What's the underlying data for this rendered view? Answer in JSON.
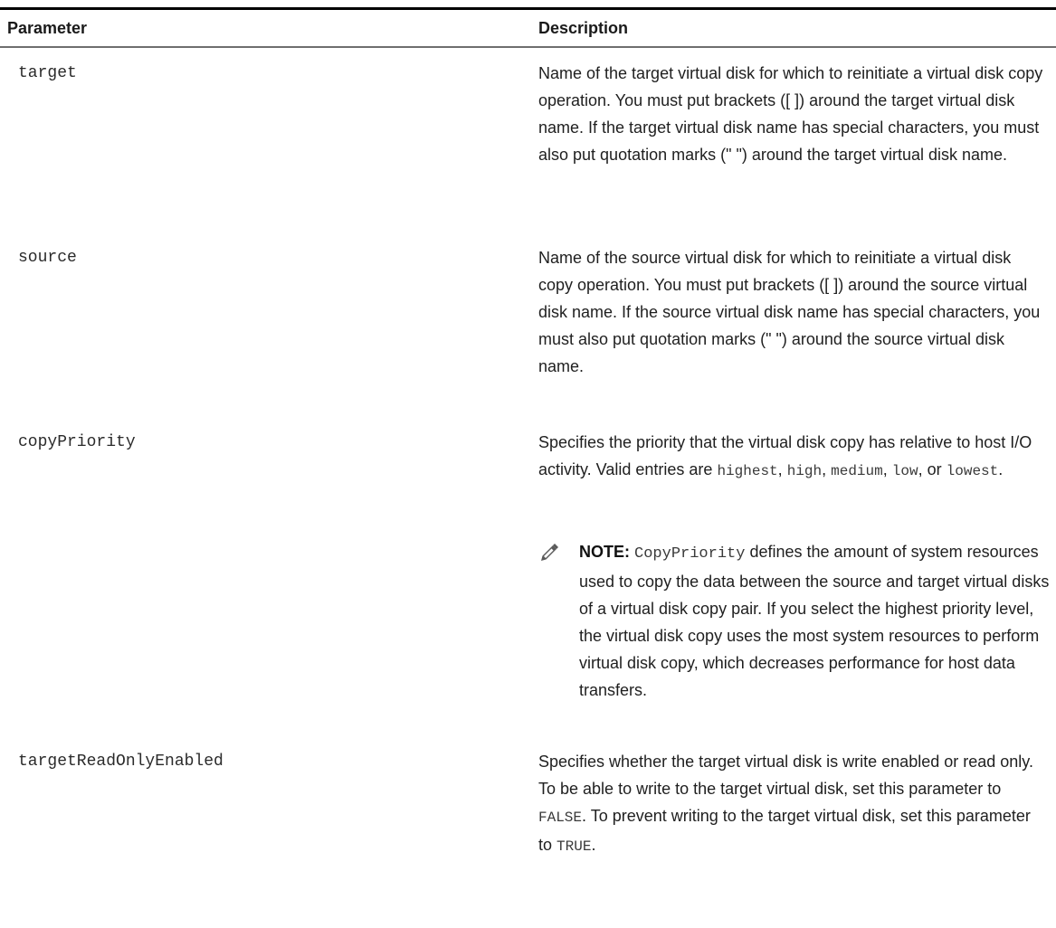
{
  "table": {
    "headers": {
      "parameter": "Parameter",
      "description": "Description"
    },
    "rows": [
      {
        "name": "target",
        "description": "Name of the target virtual disk for which to reinitiate a virtual disk copy operation. You must put brackets ([ ]) around the target virtual disk name. If the target virtual disk name has special characters, you must also put quotation marks (\" \") around the target virtual disk name."
      },
      {
        "name": "source",
        "description": "Name of the source virtual disk for which to reinitiate a virtual disk copy operation. You must put brackets ([ ]) around the source virtual disk name. If the source virtual disk name has special characters, you must also put quotation marks (\" \") around the source virtual disk name."
      },
      {
        "name": "copyPriority",
        "description": {
          "text": "Specifies the priority that the virtual disk copy has relative to host I/O activity. Valid entries are",
          "values": [
            "highest",
            "high",
            "medium",
            "low",
            "lowest"
          ],
          "sep": ",",
          "conj": "or",
          "end": "."
        },
        "note": {
          "label": "NOTE:",
          "code": "CopyPriority",
          "text": "defines the amount of system resources used to copy the data between the source and target virtual disks of a virtual disk copy pair. If you select the highest priority level, the virtual disk copy uses the most system resources to perform virtual disk copy, which decreases performance for host data transfers."
        }
      },
      {
        "name": "targetReadOnlyEnabled",
        "description": {
          "part1": "Specifies whether the target virtual disk is write enabled or read only. To be able to write to the target virtual disk, set this parameter to",
          "value1": "FALSE",
          "part2": ". To prevent writing to the target virtual disk, set this parameter to",
          "value2": "TRUE",
          "end": "."
        }
      }
    ]
  },
  "icons": {
    "note": "pencil-note-icon"
  }
}
